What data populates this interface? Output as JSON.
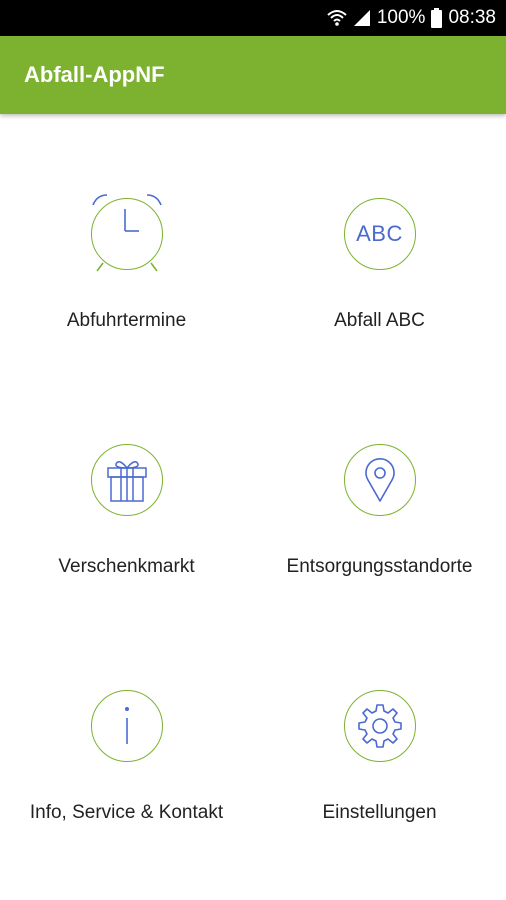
{
  "status_bar": {
    "battery": "100%",
    "time": "08:38",
    "icons": [
      "wifi-icon",
      "signal-icon",
      "battery-icon"
    ]
  },
  "app_bar": {
    "title": "Abfall-AppNF"
  },
  "menu": {
    "items": [
      {
        "label": "Abfuhrtermine",
        "icon": "alarm-clock-icon"
      },
      {
        "label": "Abfall ABC",
        "icon": "abc-icon",
        "icon_text": "ABC"
      },
      {
        "label": "Verschenkmarkt",
        "icon": "gift-icon"
      },
      {
        "label": "Entsorgungsstandorte",
        "icon": "location-pin-icon"
      },
      {
        "label": "Info, Service & Kontakt",
        "icon": "info-icon"
      },
      {
        "label": "Einstellungen",
        "icon": "gear-icon"
      }
    ]
  },
  "colors": {
    "accent_green": "#7cb230",
    "icon_blue": "#4a6ad0",
    "text": "#222222"
  }
}
